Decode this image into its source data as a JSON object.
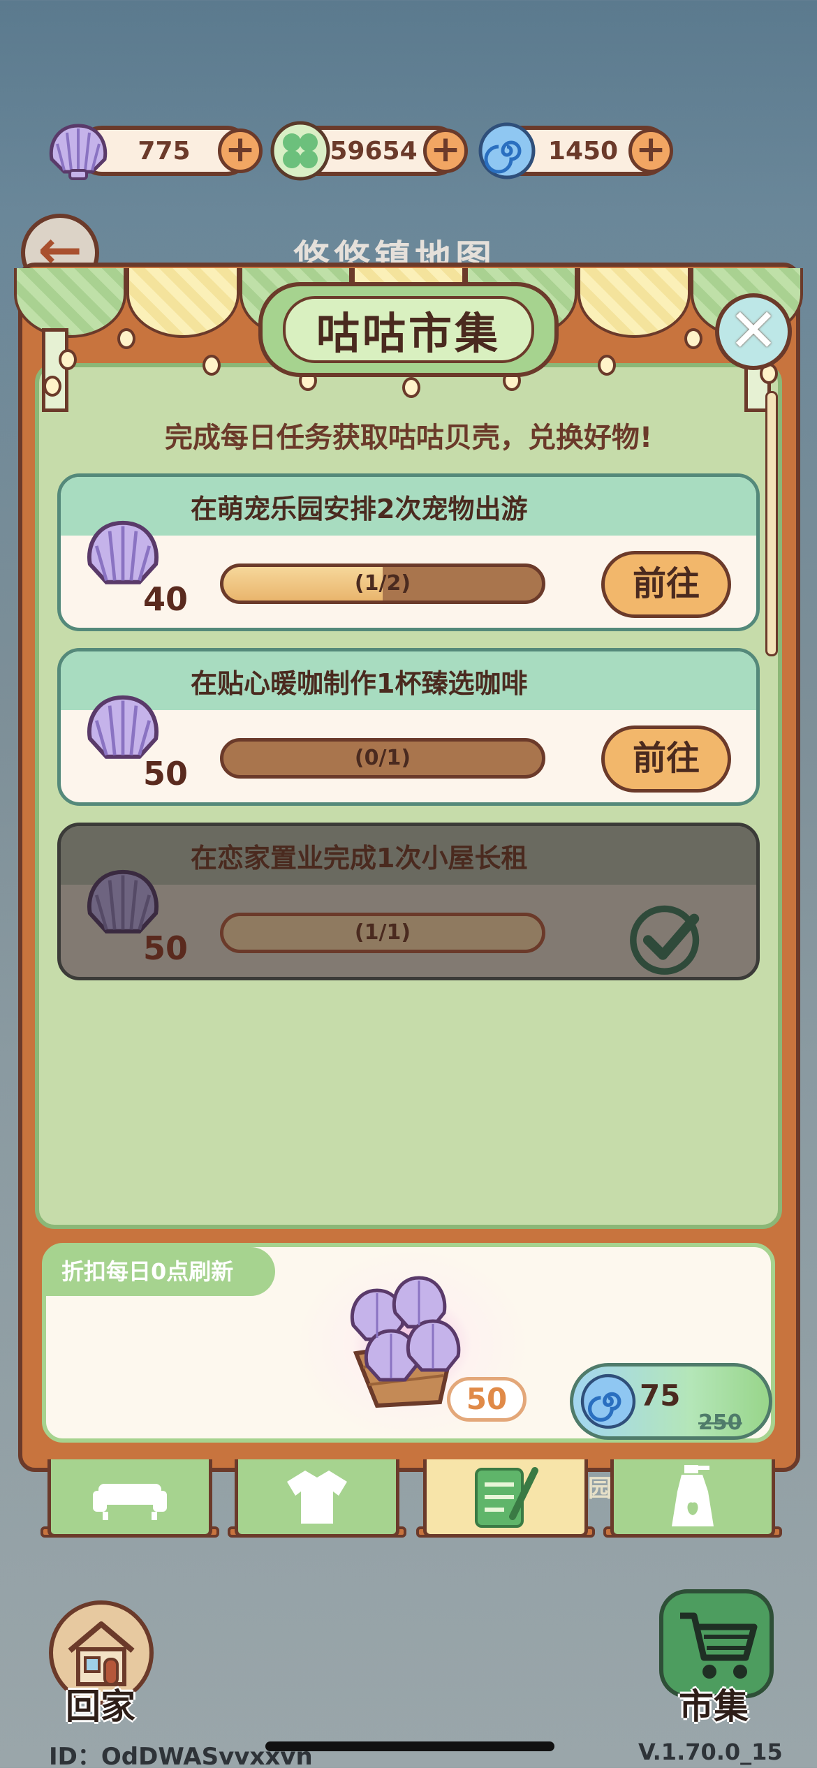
{
  "currencies": [
    {
      "name": "shell-icon",
      "value": "775",
      "color": "#b9a6e0"
    },
    {
      "name": "clover-icon",
      "value": "59654",
      "color": "#69c07a"
    },
    {
      "name": "swirl-gem-icon",
      "value": "1450",
      "color": "#5aa7e0"
    }
  ],
  "plus_symbol": "+",
  "map": {
    "back_icon": "arrow-left-icon",
    "title": "悠悠镇地图"
  },
  "panel": {
    "title": "咕咕市集",
    "close_symbol": "✕",
    "subtitle": "完成每日任务获取咕咕贝壳，兑换好物!"
  },
  "tasks": [
    {
      "title": "在萌宠乐园安排2次宠物出游",
      "reward": "40",
      "progress_text": "(1/2)",
      "progress": 0.5,
      "action": "前往",
      "done": false
    },
    {
      "title": "在贴心暖咖制作1杯臻选咖啡",
      "reward": "50",
      "progress_text": "(0/1)",
      "progress": 0.0,
      "action": "前往",
      "done": false
    },
    {
      "title": "在恋家置业完成1次小屋长租",
      "reward": "50",
      "progress_text": "(1/1)",
      "progress": 1.0,
      "action": "",
      "done": true
    }
  ],
  "discount": {
    "tag": "折扣每日0点刷新",
    "quantity": "50",
    "price": "75",
    "old_price": "250",
    "item_icon": "shell-basket-icon"
  },
  "tabs": [
    {
      "name": "tab-furniture",
      "icon": "sofa-icon",
      "active": false
    },
    {
      "name": "tab-clothing",
      "icon": "shirt-icon",
      "active": false
    },
    {
      "name": "tab-tasks",
      "icon": "notepad-icon",
      "active": true
    },
    {
      "name": "tab-items",
      "icon": "bottle-icon",
      "active": false
    }
  ],
  "tab_ghost_label": "园",
  "hud": {
    "home_label": "回家",
    "market_label": "市集",
    "user_id": "ID：OdDWASvvxxvn",
    "version": "V.1.70.0_15"
  }
}
